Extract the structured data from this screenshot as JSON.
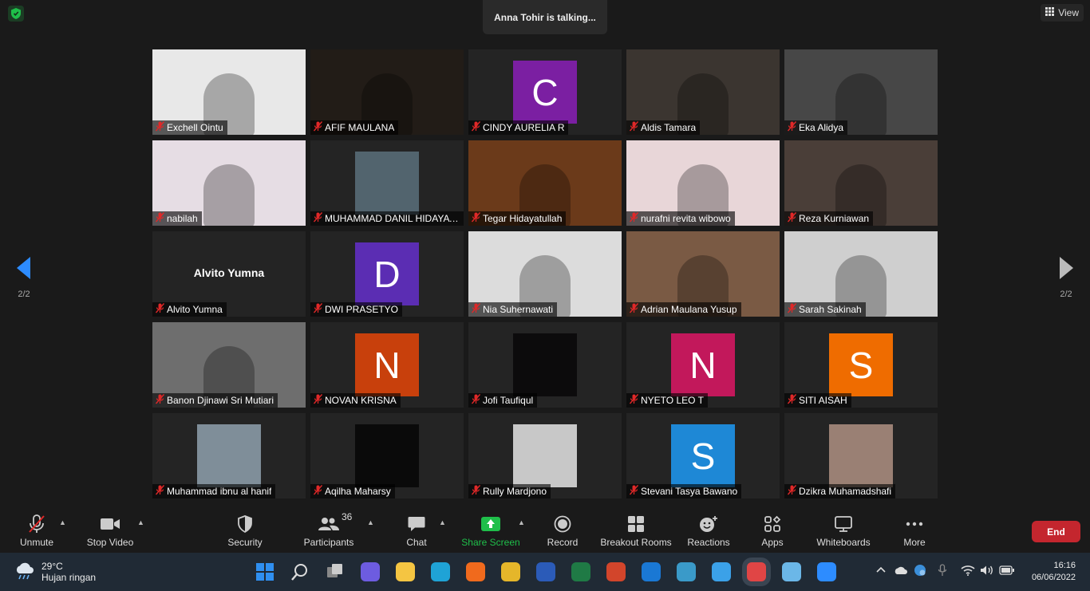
{
  "top": {
    "talking": "Anna Tohir is talking...",
    "view_label": "View"
  },
  "nav": {
    "page_left": "2/2",
    "page_right": "2/2"
  },
  "colors": {
    "mute_red": "#e02828",
    "share_green": "#1fbf4a",
    "end_red": "#c4262e"
  },
  "participants": [
    {
      "name": "Exchell Ointu",
      "kind": "photo",
      "bg": "#e8e8e8"
    },
    {
      "name": "AFIF MAULANA",
      "kind": "photo",
      "bg": "#221c17"
    },
    {
      "name": "CINDY AURELIA R",
      "kind": "avatar",
      "letter": "C",
      "color": "#7b1fa2"
    },
    {
      "name": "Aldis Tamara",
      "kind": "photo",
      "bg": "#3b3530"
    },
    {
      "name": "Eka Alidya",
      "kind": "photo",
      "bg": "#474747"
    },
    {
      "name": "nabilah",
      "kind": "photo",
      "bg": "#e6dde4"
    },
    {
      "name": "MUHAMMAD DANIL HIDAYATULLAH",
      "kind": "blur",
      "color": "#52646e"
    },
    {
      "name": "Tegar Hidayatullah",
      "kind": "photo",
      "bg": "#6b3a1a"
    },
    {
      "name": "nurafni revita wibowo",
      "kind": "photo",
      "bg": "#e8d6d8"
    },
    {
      "name": "Reza Kurniawan",
      "kind": "photo",
      "bg": "#4a3e38"
    },
    {
      "name": "Alvito Yumna",
      "kind": "text",
      "display": "Alvito Yumna"
    },
    {
      "name": "DWI PRASETYO",
      "kind": "avatar",
      "letter": "D",
      "color": "#5b2db3"
    },
    {
      "name": "Nia Suhernawati",
      "kind": "photo",
      "bg": "#dcdcdc"
    },
    {
      "name": "Adrian Maulana Yusup",
      "kind": "photo",
      "bg": "#7a5a44"
    },
    {
      "name": "Sarah Sakinah",
      "kind": "photo",
      "bg": "#cfcfcf"
    },
    {
      "name": "Banon Djinawi Sri Mutiari",
      "kind": "photo",
      "bg": "#6e6e6e"
    },
    {
      "name": "NOVAN KRISNA",
      "kind": "avatar",
      "letter": "N",
      "color": "#c8400c"
    },
    {
      "name": "Jofi Taufiqul",
      "kind": "blur",
      "color": "#0c0b0c"
    },
    {
      "name": "NYETO LEO T",
      "kind": "avatar",
      "letter": "N",
      "color": "#c2185b"
    },
    {
      "name": "SITI AISAH",
      "kind": "avatar",
      "letter": "S",
      "color": "#ef6c00"
    },
    {
      "name": "Muhammad ibnu al hanif",
      "kind": "thumb",
      "color": "#7f8e99"
    },
    {
      "name": "Aqilha Maharsy",
      "kind": "blur",
      "color": "#0a0a0a"
    },
    {
      "name": "Rully Mardjono",
      "kind": "thumb",
      "color": "#c8c8c8"
    },
    {
      "name": "Stevani Tasya Bawano",
      "kind": "avatar",
      "letter": "S",
      "color": "#1e88d6"
    },
    {
      "name": "Dzikra Muhamadshafi",
      "kind": "blur",
      "color": "#9a8074"
    }
  ],
  "toolbar": {
    "unmute": "Unmute",
    "stop_video": "Stop Video",
    "security": "Security",
    "participants": "Participants",
    "participants_count": "36",
    "chat": "Chat",
    "share_screen": "Share Screen",
    "record": "Record",
    "breakout_rooms": "Breakout Rooms",
    "reactions": "Reactions",
    "apps": "Apps",
    "whiteboards": "Whiteboards",
    "more": "More",
    "end": "End"
  },
  "taskbar": {
    "temp": "29°C",
    "weather": "Hujan ringan",
    "time": "16:16",
    "date": "06/06/2022",
    "apps": [
      {
        "icon": "windows-start-icon",
        "color": "#2f8ff0"
      },
      {
        "icon": "search-icon",
        "color": "#dddddd"
      },
      {
        "icon": "task-view-icon",
        "color": "#cccccc"
      },
      {
        "icon": "teams-chat-icon",
        "color": "#6d5ce0"
      },
      {
        "icon": "file-explorer-icon",
        "color": "#f4c542"
      },
      {
        "icon": "edge-icon",
        "color": "#1fa3d6"
      },
      {
        "icon": "firefox-icon",
        "color": "#f06a1d"
      },
      {
        "icon": "chrome-icon",
        "color": "#e5b62a"
      },
      {
        "icon": "word-icon",
        "color": "#2b5bb8"
      },
      {
        "icon": "excel-icon",
        "color": "#1f7a45"
      },
      {
        "icon": "powerpoint-icon",
        "color": "#d2452b"
      },
      {
        "icon": "mail-icon",
        "color": "#1a78d4"
      },
      {
        "icon": "news-icon",
        "color": "#3a9ac9"
      },
      {
        "icon": "photos-icon",
        "color": "#3ba1e8"
      },
      {
        "icon": "snipping-tool-icon",
        "color": "#e04545"
      },
      {
        "icon": "notepad-icon",
        "color": "#6bb7e8"
      },
      {
        "icon": "zoom-icon",
        "color": "#2d8cff"
      }
    ]
  }
}
